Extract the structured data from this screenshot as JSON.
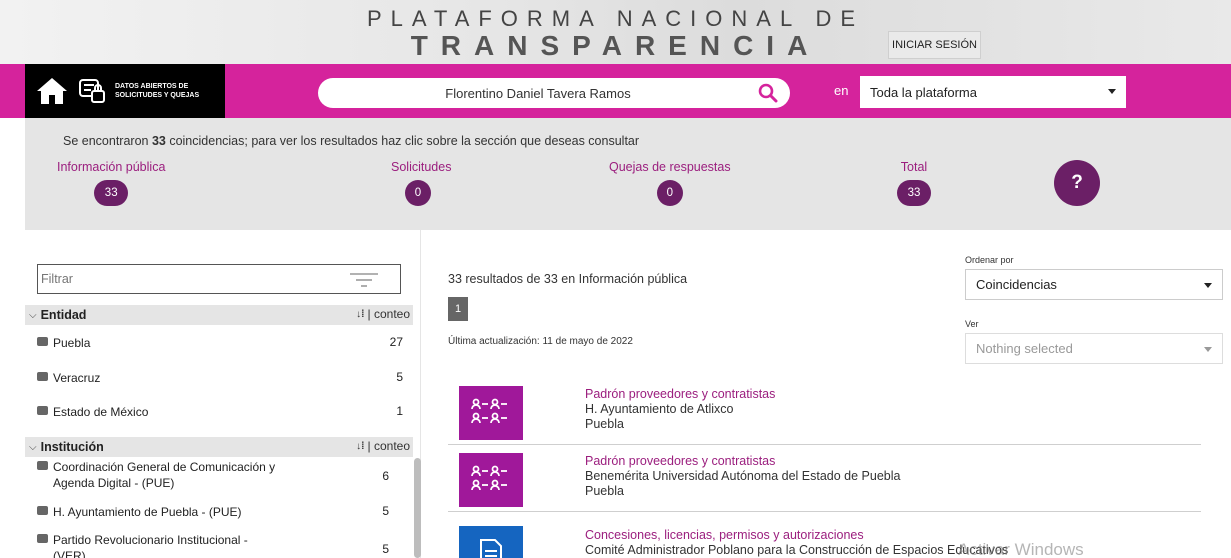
{
  "header": {
    "title_line1": "PLATAFORMA NACIONAL DE",
    "title_line2": "TRANSPARENCIA",
    "login_label": "INICIAR SESIÓN"
  },
  "navbar": {
    "brand_text": "DATOS ABIERTOS DE SOLICITUDES Y QUEJAS",
    "search_value": "Florentino Daniel Tavera Ramos",
    "en_label": "en",
    "scope_selected": "Toda la plataforma",
    "colors": {
      "bar": "#d5239c",
      "brand_bg": "#000000"
    }
  },
  "summary": {
    "text_before": "Se encontraron ",
    "count": "33",
    "text_after": " coincidencias; para ver los resultados haz clic sobre la sección que deseas consultar",
    "stats": [
      {
        "label": "Información pública",
        "count": "33"
      },
      {
        "label": "Solicitudes",
        "count": "0"
      },
      {
        "label": "Quejas de respuestas",
        "count": "0"
      },
      {
        "label": "Total",
        "count": "33"
      }
    ],
    "help_label": "?",
    "accent": "#6b1f66"
  },
  "sidebar": {
    "filter_placeholder": "Filtrar",
    "sections": [
      {
        "title": "Entidad",
        "sort_label": "conteo",
        "items": [
          {
            "name": "Puebla",
            "count": "27"
          },
          {
            "name": "Veracruz",
            "count": "5"
          },
          {
            "name": "Estado de México",
            "count": "1"
          }
        ]
      },
      {
        "title": "Institución",
        "sort_label": "conteo",
        "items": [
          {
            "name": "Coordinación General de Comunicación y Agenda Digital - (PUE)",
            "count": "6"
          },
          {
            "name": "H. Ayuntamiento de Puebla - (PUE)",
            "count": "5"
          },
          {
            "name": "Partido Revolucionario Institucional - (VER)",
            "count": "5"
          }
        ]
      }
    ]
  },
  "main": {
    "results_count": "33",
    "results_total": "33",
    "results_of": " resultados de ",
    "results_in": " en Información pública",
    "page_number": "1",
    "last_update": "Última actualización: 11 de mayo de 2022",
    "sort_label": "Ordenar por",
    "sort_selected": "Coincidencias",
    "view_label": "Ver",
    "view_placeholder": "Nothing selected",
    "results": [
      {
        "title": "Padrón proveedores y contratistas",
        "institution": "H. Ayuntamiento de Atlixco",
        "state": "Puebla",
        "icon": "list-users-icon",
        "icon_color": "#a0189a"
      },
      {
        "title": "Padrón proveedores y contratistas",
        "institution": "Benemérita Universidad Autónoma del Estado de Puebla",
        "state": "Puebla",
        "icon": "list-users-icon",
        "icon_color": "#a0189a"
      },
      {
        "title": "Concesiones, licencias, permisos y autorizaciones",
        "institution": "Comité Administrador Poblano para la Construcción de Espacios Educativos",
        "state": "",
        "icon": "document-icon",
        "icon_color": "#1565c0"
      }
    ]
  },
  "os_watermark": "Activar Windows"
}
